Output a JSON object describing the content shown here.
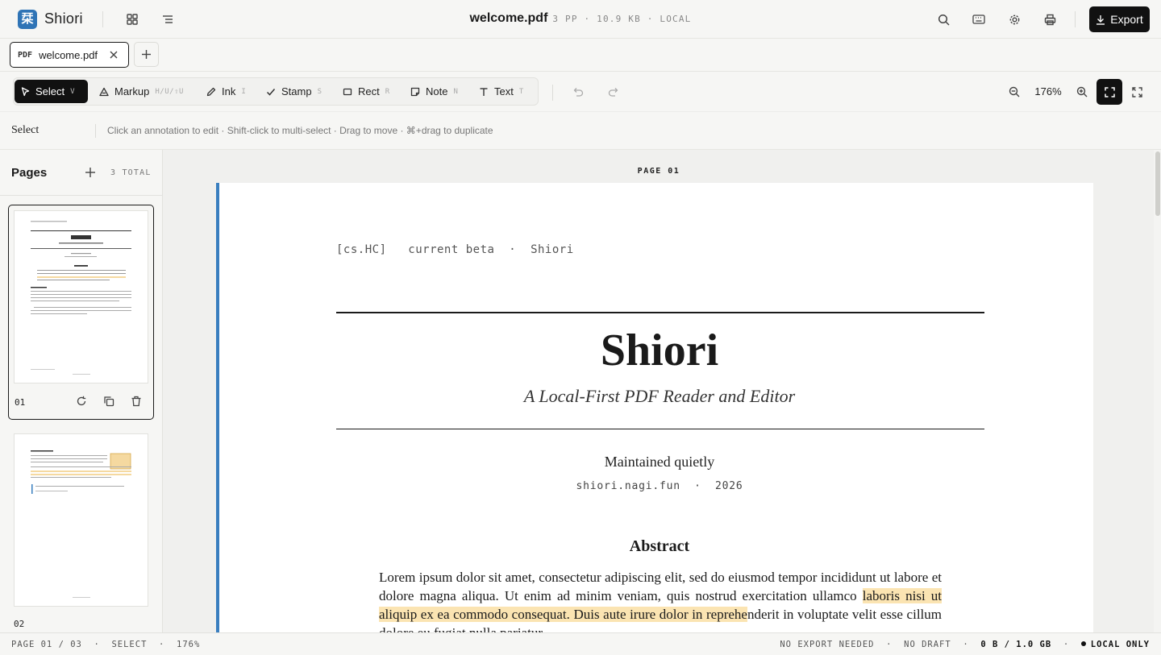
{
  "app": {
    "logo_glyph": "栞",
    "brand": "Shiori",
    "accent": "#2f74b6"
  },
  "document": {
    "filename": "welcome.pdf",
    "meta": "3 PP · 10.9 KB · LOCAL"
  },
  "header": {
    "export_label": "Export",
    "icons": [
      "grid-icon",
      "list-icon",
      "search-icon",
      "keyboard-icon",
      "gear-icon",
      "print-icon",
      "download-icon"
    ]
  },
  "tabs": [
    {
      "badge": "PDF",
      "label": "welcome.pdf"
    }
  ],
  "tools": [
    {
      "label": "Select",
      "key": "V",
      "icon": "cursor-icon",
      "active": true
    },
    {
      "label": "Markup",
      "key": "H/U/⇧U",
      "icon": "highlighter-icon"
    },
    {
      "label": "Ink",
      "key": "I",
      "icon": "pen-icon"
    },
    {
      "label": "Stamp",
      "key": "S",
      "icon": "check-icon"
    },
    {
      "label": "Rect",
      "key": "R",
      "icon": "rect-icon"
    },
    {
      "label": "Note",
      "key": "N",
      "icon": "note-icon"
    },
    {
      "label": "Text",
      "key": "T",
      "icon": "text-icon"
    }
  ],
  "zoom": {
    "value": "176%"
  },
  "hint_bar": {
    "mode": "Select",
    "hint": "Click an annotation to edit · Shift-click to multi-select · Drag to move · ⌘+drag to duplicate"
  },
  "sidebar": {
    "title": "Pages",
    "total": "3 TOTAL",
    "pages": [
      {
        "number": "01",
        "selected": true
      },
      {
        "number": "02",
        "selected": false
      }
    ]
  },
  "viewer": {
    "page_label": "PAGE 01",
    "page": {
      "header": "[cs.HC]   current beta  ·  Shiori",
      "title": "Shiori",
      "subtitle": "A Local-First PDF Reader and Editor",
      "maintained": "Maintained quietly",
      "site": "shiori.nagi.fun  ·  2026",
      "abstract_heading": "Abstract",
      "abstract_part1": "Lorem ipsum dolor sit amet, consectetur adipiscing elit, sed do eiusmod tempor incididunt ut labore et dolore magna aliqua. Ut enim ad minim veniam, quis nostrud exercitation ullamco ",
      "abstract_highlight": "laboris nisi ut aliquip ex ea commodo consequat. Duis aute irure dolor in reprehe",
      "abstract_part2": "nderit in voluptate velit esse cillum dolore eu fugiat nulla pariatur.",
      "highlight_color": "#fbe4b2"
    }
  },
  "status": {
    "page": "PAGE 01 / 03",
    "mode": "SELECT",
    "zoom": "176%",
    "export": "NO EXPORT NEEDED",
    "draft": "NO DRAFT",
    "storage": "0 B / 1.0 GB",
    "local": "LOCAL ONLY"
  }
}
